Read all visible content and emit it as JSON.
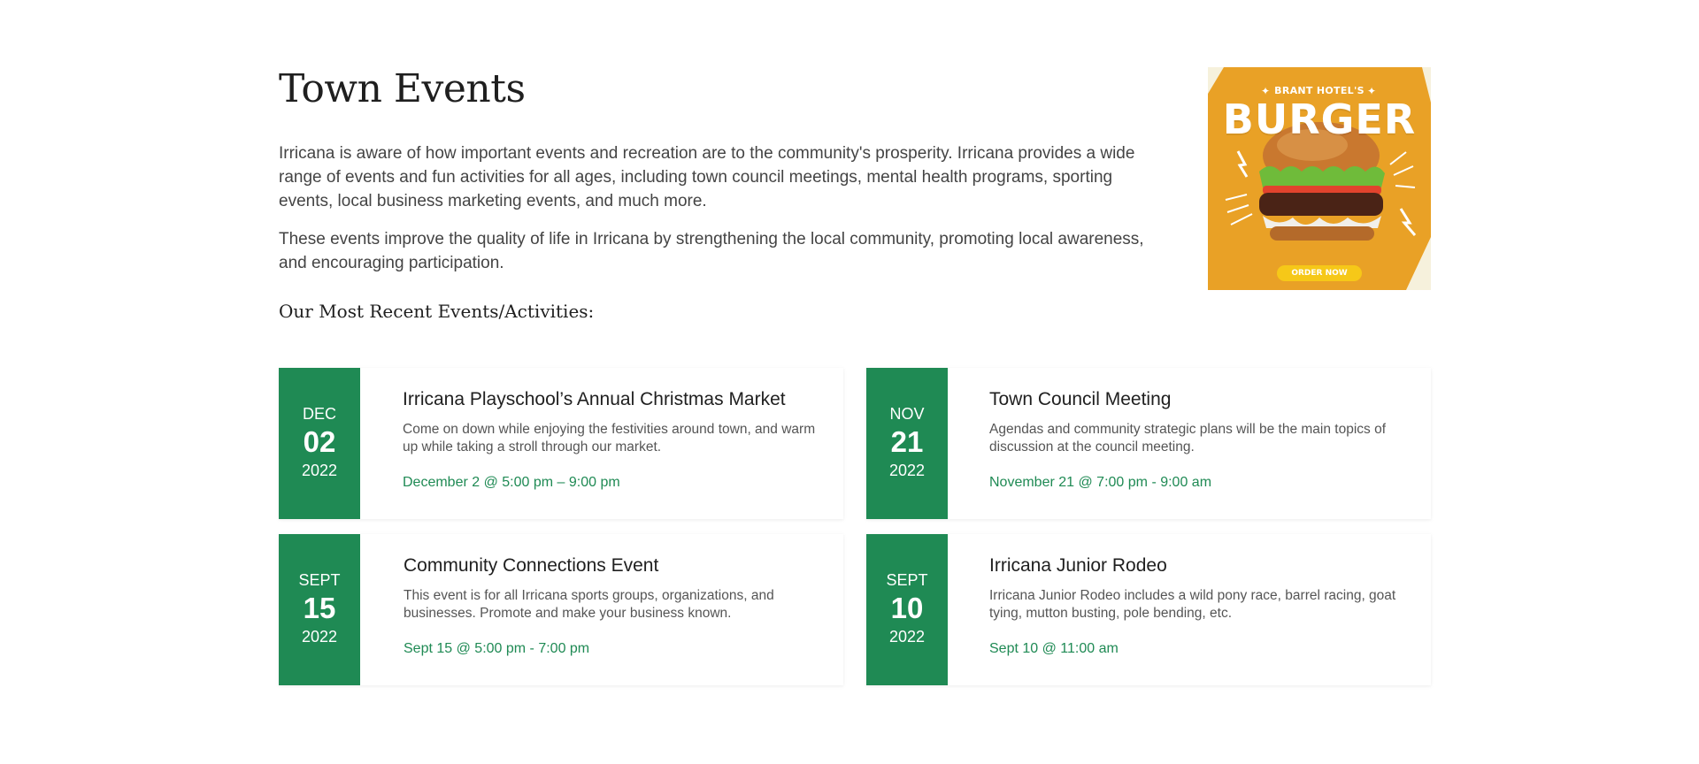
{
  "page": {
    "title": "Town Events",
    "paragraphs": [
      "Irricana is aware of how important events and recreation are to the community's prosperity. Irricana provides a wide range of events and fun activities for all ages, including town council meetings, mental health programs, sporting events, local business marketing events, and much more.",
      "These events improve the quality of life in Irricana by strengthening the local community, promoting local awareness, and encouraging participation."
    ],
    "subheading": "Our Most Recent Events/Activities:"
  },
  "ad": {
    "hotel": "BRANT HOTEL'S",
    "headline": "BURGER",
    "cta": "ORDER NOW",
    "bg_color": "#e9a126"
  },
  "events": [
    {
      "month": "DEC",
      "day": "02",
      "year": "2022",
      "title": "Irricana Playschool’s Annual Christmas Market",
      "description": "Come on down while enjoying the festivities around town, and warm up while taking a stroll through our market.",
      "time": "December 2 @ 5:00 pm – 9:00 pm"
    },
    {
      "month": "NOV",
      "day": "21",
      "year": "2022",
      "title": "Town Council Meeting",
      "description": "Agendas and community strategic plans will be the main topics of discussion at the council meeting.",
      "time": "November 21 @ 7:00 pm - 9:00 am"
    },
    {
      "month": "SEPT",
      "day": "15",
      "year": "2022",
      "title": "Community Connections Event",
      "description": "This event is for all Irricana sports groups, organizations, and businesses. Promote and make your business known.",
      "time": "Sept 15 @ 5:00 pm - 7:00 pm"
    },
    {
      "month": "SEPT",
      "day": "10",
      "year": "2022",
      "title": "Irricana Junior Rodeo",
      "description": "Irricana Junior Rodeo includes a wild pony race, barrel racing, goat tying, mutton busting, pole bending, etc.",
      "time": "Sept 10 @ 11:00 am"
    }
  ],
  "colors": {
    "accent": "#1f8a54",
    "text": "#444444",
    "heading": "#1f1f1f"
  }
}
